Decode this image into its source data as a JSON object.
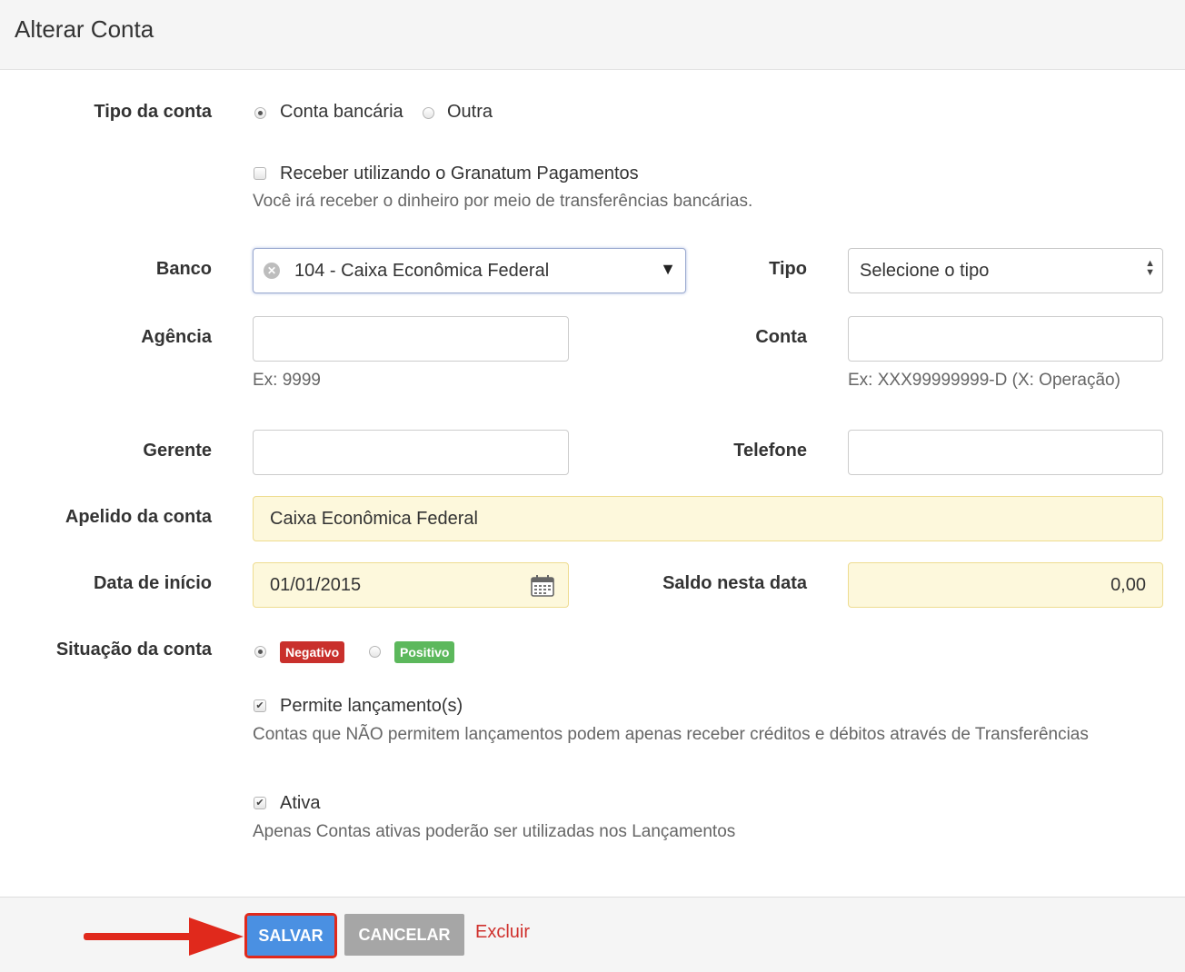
{
  "header": {
    "title": "Alterar Conta"
  },
  "tipo_conta": {
    "label": "Tipo da conta",
    "options": [
      {
        "label": "Conta bancária",
        "checked": true
      },
      {
        "label": "Outra",
        "checked": false
      }
    ]
  },
  "granatum": {
    "label": "Receber utilizando o Granatum Pagamentos",
    "checked": false,
    "help": "Você irá receber o dinheiro por meio de transferências bancárias."
  },
  "banco": {
    "label": "Banco",
    "value": "104 - Caixa Econômica Federal"
  },
  "tipo": {
    "label": "Tipo",
    "value": "Selecione o tipo"
  },
  "agencia": {
    "label": "Agência",
    "value": "",
    "help": "Ex: 9999"
  },
  "conta": {
    "label": "Conta",
    "value": "",
    "help": "Ex: XXX99999999-D (X: Operação)"
  },
  "gerente": {
    "label": "Gerente",
    "value": ""
  },
  "telefone": {
    "label": "Telefone",
    "value": ""
  },
  "apelido": {
    "label": "Apelido da conta",
    "value": "Caixa Econômica Federal"
  },
  "data_inicio": {
    "label": "Data de início",
    "value": "01/01/2015"
  },
  "saldo": {
    "label": "Saldo nesta data",
    "value": "0,00"
  },
  "situacao": {
    "label": "Situação da conta",
    "negativo": {
      "label": "Negativo",
      "checked": true,
      "color": "#c9302c"
    },
    "positivo": {
      "label": "Positivo",
      "checked": false,
      "color": "#5cb85c"
    }
  },
  "permite": {
    "label": "Permite lançamento(s)",
    "checked": true,
    "help": "Contas que NÃO permitem lançamentos podem apenas receber créditos e débitos através de Transferências"
  },
  "ativa": {
    "label": "Ativa",
    "checked": true,
    "help": "Apenas Contas ativas poderão ser utilizadas nos Lançamentos"
  },
  "footer": {
    "save_label": "SALVAR",
    "cancel_label": "CANCELAR",
    "delete_label": "Excluir",
    "save_color": "#4a90e2",
    "highlight_color": "#e0291c"
  }
}
